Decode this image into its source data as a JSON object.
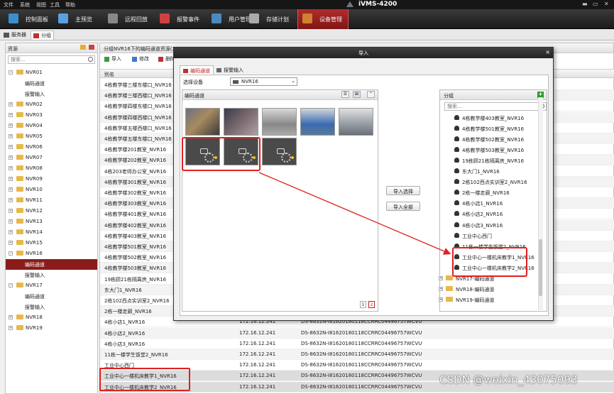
{
  "menubar": {
    "items": [
      "文件",
      "系统",
      "视图",
      "工具",
      "帮助"
    ],
    "app_title": "iVMS-4200",
    "window_controls": [
      "▬",
      "▭",
      "✕"
    ]
  },
  "navbar": {
    "tabs": [
      {
        "label": "控制面板",
        "icon": "control-panel-icon",
        "color": "#3a8fd0"
      },
      {
        "label": "主预览",
        "icon": "preview-icon",
        "color": "#5aa0e0"
      },
      {
        "label": "远程回放",
        "icon": "playback-icon",
        "color": "#888"
      },
      {
        "label": "报警事件",
        "icon": "alarm-icon",
        "color": "#d04040"
      },
      {
        "label": "用户管理",
        "icon": "user-icon",
        "color": "#4a8ac0"
      },
      {
        "label": "存储计划",
        "icon": "storage-icon",
        "color": "#aaa"
      },
      {
        "label": "设备管理",
        "icon": "device-icon",
        "color": "#d08030"
      }
    ]
  },
  "subtabs": [
    "服务器",
    "分组"
  ],
  "left": {
    "title": "资源",
    "search_placeholder": "搜索...",
    "tree": [
      {
        "label": "NVR01",
        "type": "folder",
        "exp": "−"
      },
      {
        "label": "编码通道",
        "type": "child"
      },
      {
        "label": "报警输入",
        "type": "child"
      },
      {
        "label": "NVR02",
        "type": "folder",
        "exp": "+"
      },
      {
        "label": "NVR03",
        "type": "folder",
        "exp": "+"
      },
      {
        "label": "NVR04",
        "type": "folder",
        "exp": "+"
      },
      {
        "label": "NVR05",
        "type": "folder",
        "exp": "+"
      },
      {
        "label": "NVR06",
        "type": "folder",
        "exp": "+"
      },
      {
        "label": "NVR07",
        "type": "folder",
        "exp": "+"
      },
      {
        "label": "NVR08",
        "type": "folder",
        "exp": "+"
      },
      {
        "label": "NVR09",
        "type": "folder",
        "exp": "+"
      },
      {
        "label": "NVR10",
        "type": "folder",
        "exp": "+"
      },
      {
        "label": "NVR11",
        "type": "folder",
        "exp": "+"
      },
      {
        "label": "NVR12",
        "type": "folder",
        "exp": "+"
      },
      {
        "label": "NVR13",
        "type": "folder",
        "exp": "+"
      },
      {
        "label": "NVR14",
        "type": "folder",
        "exp": "+"
      },
      {
        "label": "NVR15",
        "type": "folder",
        "exp": "+"
      },
      {
        "label": "NVR16",
        "type": "folder",
        "exp": "−"
      },
      {
        "label": "编码通道",
        "type": "child",
        "selected": true
      },
      {
        "label": "报警输入",
        "type": "child"
      },
      {
        "label": "NVR17",
        "type": "folder",
        "exp": "−"
      },
      {
        "label": "编码通道",
        "type": "child"
      },
      {
        "label": "报警输入",
        "type": "child"
      },
      {
        "label": "NVR18",
        "type": "folder",
        "exp": "+"
      },
      {
        "label": "NVR19",
        "type": "folder",
        "exp": "+"
      }
    ]
  },
  "main": {
    "header": "分组NVR16下的编码通道资源(32",
    "toolbar": {
      "import": "导入",
      "modify": "修改",
      "delete": "删除"
    },
    "columns": [
      "别名"
    ],
    "rows": [
      [
        "4栋教学楼三楼东楼口_NVR16",
        "",
        "",
        ""
      ],
      [
        "4栋教学楼三楼西楼口_NVR16",
        "",
        "",
        ""
      ],
      [
        "4栋教学楼四楼东楼口_NVR16",
        "",
        "",
        ""
      ],
      [
        "4栋教学楼四楼西楼口_NVR16",
        "",
        "",
        ""
      ],
      [
        "4栋教学楼五楼西楼口_NVR16",
        "",
        "",
        ""
      ],
      [
        "4栋教学楼五楼东楼口_NVR16",
        "",
        "",
        ""
      ],
      [
        "4栋教学楼201教室_NVR16",
        "",
        "",
        ""
      ],
      [
        "4栋教学楼202教室_NVR16",
        "",
        "",
        ""
      ],
      [
        "4栋203老师办公室_NVR16",
        "",
        "",
        ""
      ],
      [
        "4栋教学楼301教室_NVR16",
        "",
        "",
        ""
      ],
      [
        "4栋教学楼302教室_NVR16",
        "",
        "",
        ""
      ],
      [
        "4栋教学楼303教室_NVR16",
        "",
        "",
        ""
      ],
      [
        "4栋教学楼401教室_NVR16",
        "",
        "",
        ""
      ],
      [
        "4栋教学楼402教室_NVR16",
        "",
        "",
        ""
      ],
      [
        "4栋教学楼403教室_NVR16",
        "",
        "",
        ""
      ],
      [
        "4栋教学楼501教室_NVR16",
        "",
        "",
        ""
      ],
      [
        "4栋教学楼502教室_NVR16",
        "",
        "",
        ""
      ],
      [
        "4栋教学楼503教室_NVR16",
        "",
        "",
        ""
      ],
      [
        "19栋顾21栋隔离房_NVR16",
        "",
        "",
        ""
      ],
      [
        "东大门1_NVR16",
        "",
        "",
        ""
      ],
      [
        "2栋102西点实训室2_NVR16",
        "",
        "",
        ""
      ],
      [
        "2栋一楼走廊_NVR16",
        "",
        "",
        ""
      ],
      [
        "4栋小店1_NVR16",
        "172.16.12.241",
        "DS-8632N-I81620180118CCRRC04496757WCVU",
        ""
      ],
      [
        "4栋小店2_NVR16",
        "172.16.12.241",
        "DS-8632N-I81620180118CCRRC04496757WCVU",
        ""
      ],
      [
        "4栋小店3_NVR16",
        "172.16.12.241",
        "DS-8632N-I81620180118CCRRC04496757WCVU",
        ""
      ],
      [
        "11栋一楼学生饭堂2_NVR16",
        "172.16.12.241",
        "DS-8632N-I81620180118CCRRC04496757WCVU",
        ""
      ],
      [
        "工业中心西门",
        "172.16.12.241",
        "DS-8632N-I81620180118CCRRC04496757WCVU",
        ""
      ],
      [
        "工业中心一楼机床教学1_NVR16",
        "172.16.12.241",
        "DS-8632N-I81620180118CCRRC04496757WCVU",
        ""
      ],
      [
        "工业中心一楼机床教学2_NVR16",
        "172.16.12.241",
        "DS-8632N-I81620180118CCRRC04496757WCVU",
        ""
      ]
    ]
  },
  "dialog": {
    "title": "导入",
    "close": "×",
    "tabs": [
      "编码通道",
      "报警输入"
    ],
    "select_label": "选择设备",
    "device": "NVR16",
    "enc_title": "编码通道",
    "view_buttons": [
      "☰",
      "⊞",
      "⌃"
    ],
    "import_selected": "导入选择",
    "import_all": "导入全部",
    "pages": [
      "1",
      "2"
    ],
    "group": {
      "title": "分组",
      "add": "+",
      "search_placeholder": "搜索...",
      "items": [
        {
          "label": "4栋教学楼403教室_NVR16",
          "type": "cam"
        },
        {
          "label": "4栋教学楼501教室_NVR16",
          "type": "cam"
        },
        {
          "label": "4栋教学楼502教室_NVR16",
          "type": "cam"
        },
        {
          "label": "4栋教学楼503教室_NVR16",
          "type": "cam"
        },
        {
          "label": "19栋顾21栋隔离房_NVR16",
          "type": "cam"
        },
        {
          "label": "东大门1_NVR16",
          "type": "cam"
        },
        {
          "label": "2栋102西点实训室2_NVR16",
          "type": "cam"
        },
        {
          "label": "2栋一楼走廊_NVR16",
          "type": "cam"
        },
        {
          "label": "4栋小店1_NVR16",
          "type": "cam"
        },
        {
          "label": "4栋小店2_NVR16",
          "type": "cam"
        },
        {
          "label": "4栋小店3_NVR16",
          "type": "cam"
        },
        {
          "label": "工业中心西门",
          "type": "cam"
        },
        {
          "label": "11栋一楼学生饭堂2_NVR16",
          "type": "cam"
        },
        {
          "label": "工业中心一楼机床教学1_NVR16",
          "type": "cam"
        },
        {
          "label": "工业中心一楼机床教学2_NVR16",
          "type": "cam"
        },
        {
          "label": "NVR17-编码通道",
          "type": "folder"
        },
        {
          "label": "NVR18-编码通道",
          "type": "folder"
        },
        {
          "label": "NVR19-编码通道",
          "type": "folder"
        }
      ]
    }
  },
  "watermark": "CSDN @weixin_43075093",
  "colors": {
    "accent": "#8a1c1c",
    "highlight": "#e02020"
  }
}
